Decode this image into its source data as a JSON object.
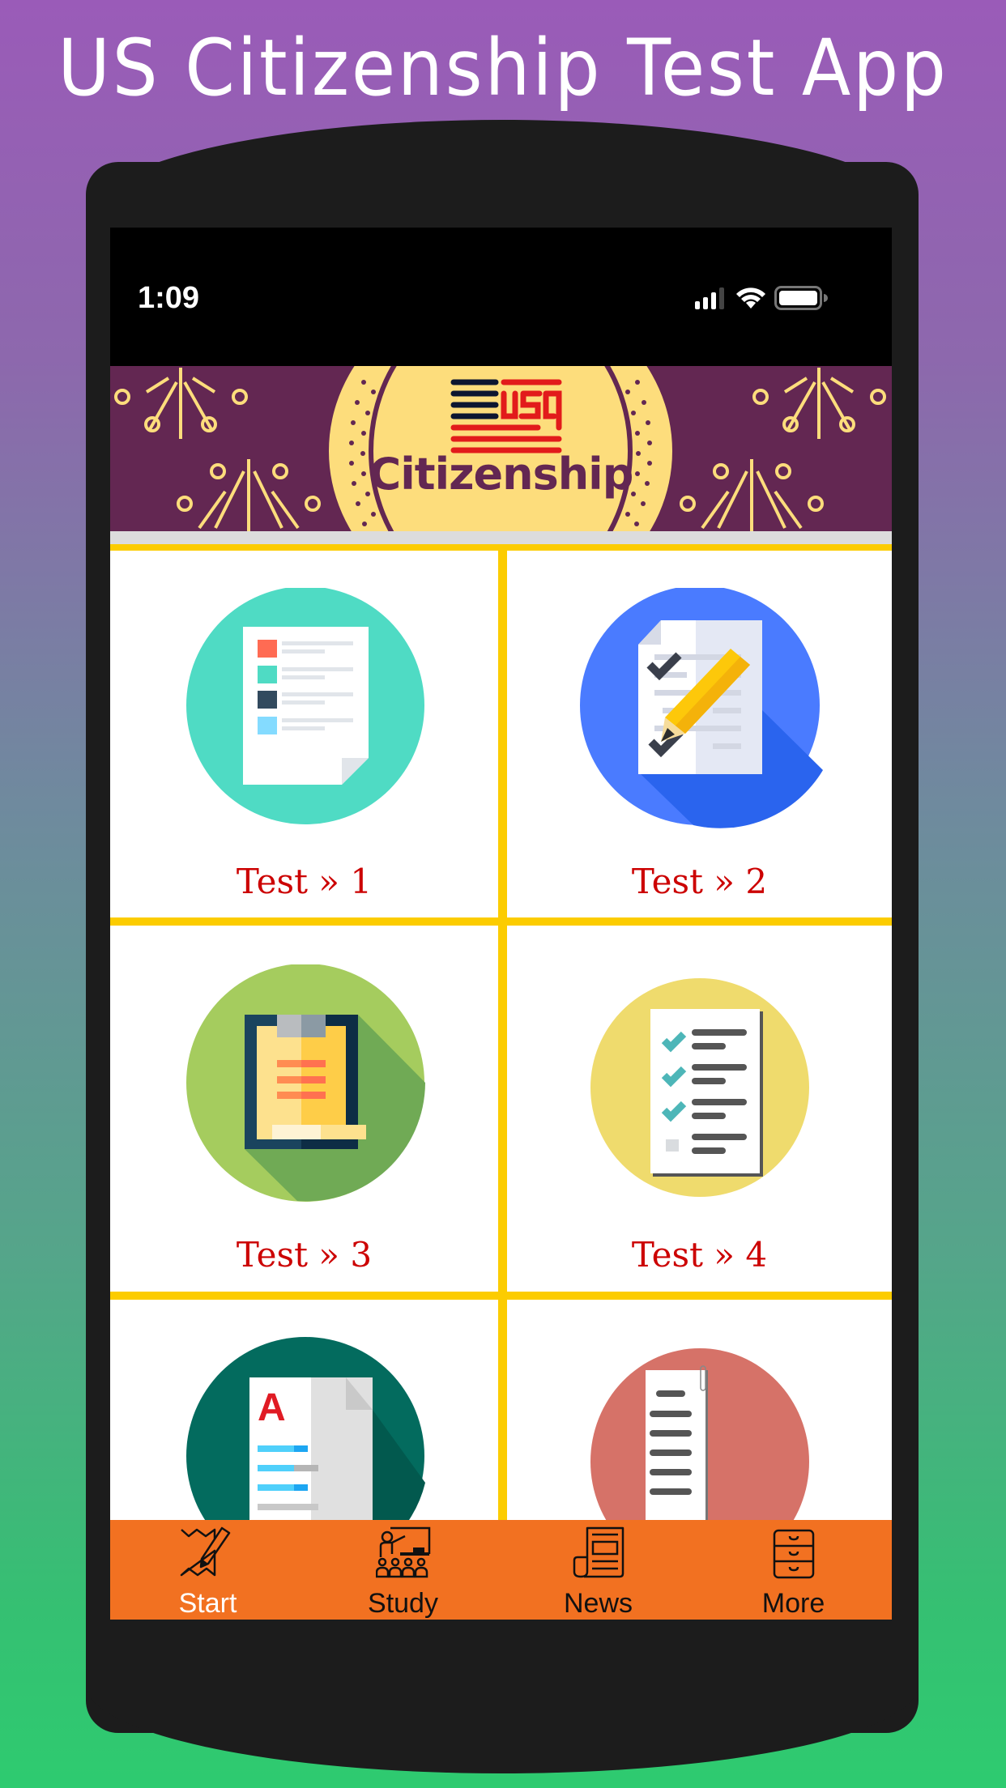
{
  "promo": {
    "title": "US Citizenship Test App"
  },
  "status_bar": {
    "time": "1:09",
    "icons": [
      "cellular-signal-icon",
      "wifi-icon",
      "battery-icon"
    ]
  },
  "banner": {
    "logo_text": "USA",
    "title": "Citizenship",
    "colors": {
      "background": "#632752",
      "medallion": "#fddd7c",
      "red": "#e21b1b",
      "navy": "#0d1630"
    }
  },
  "grid": {
    "border_color": "#fccc00",
    "label_color": "#cc0000",
    "items": [
      {
        "label": "Test » 1",
        "icon": "document-list-icon",
        "circle_color": "#4fdbc4"
      },
      {
        "label": "Test » 2",
        "icon": "checklist-pencil-icon",
        "circle_color": "#4a7bff"
      },
      {
        "label": "Test » 3",
        "icon": "clipboard-icon",
        "circle_color": "#a5cc5e"
      },
      {
        "label": "Test » 4",
        "icon": "checklist-icon",
        "circle_color": "#efdb6d"
      },
      {
        "label": "",
        "icon": "grade-document-icon",
        "circle_color": "#036b5e"
      },
      {
        "label": "",
        "icon": "text-document-icon",
        "circle_color": "#d67268"
      }
    ]
  },
  "tab_bar": {
    "background": "#f27121",
    "active_index": 0,
    "items": [
      {
        "label": "Start",
        "icon": "map-pencil-icon"
      },
      {
        "label": "Study",
        "icon": "classroom-icon"
      },
      {
        "label": "News",
        "icon": "newspaper-icon"
      },
      {
        "label": "More",
        "icon": "file-cabinet-icon"
      }
    ]
  }
}
